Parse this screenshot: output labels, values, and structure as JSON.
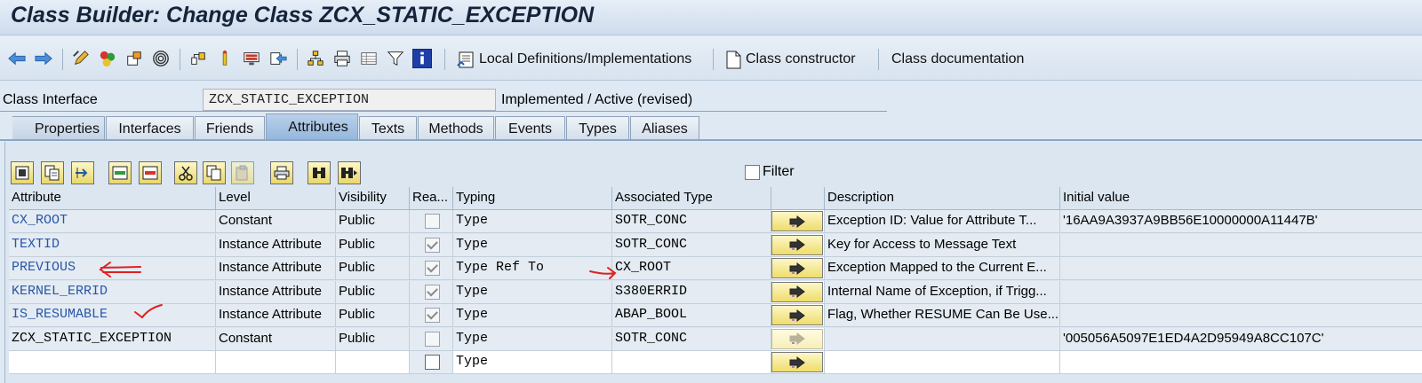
{
  "window": {
    "title": "Class Builder: Change Class ZCX_STATIC_EXCEPTION"
  },
  "toolbar": {
    "icons": [
      "back-arrow-icon",
      "forward-arrow-icon",
      "edit-pencil-icon",
      "check-icon",
      "activate-icon",
      "where-used-icon",
      "object-list-icon",
      "info-icon",
      "display-object-icon",
      "navigate-icon",
      "hierarchy-icon",
      "print-icon",
      "table-icon",
      "filter-icon",
      "help-info-icon"
    ],
    "local_defs_label": "Local Definitions/Implementations",
    "class_constructor_label": "Class constructor",
    "class_documentation_label": "Class documentation"
  },
  "iface": {
    "label": "Class Interface",
    "value": "ZCX_STATIC_EXCEPTION",
    "status": "Implemented / Active (revised)"
  },
  "tabs": [
    {
      "label": "Properties"
    },
    {
      "label": "Interfaces"
    },
    {
      "label": "Friends"
    },
    {
      "label": "Attributes"
    },
    {
      "label": "Texts"
    },
    {
      "label": "Methods"
    },
    {
      "label": "Events"
    },
    {
      "label": "Types"
    },
    {
      "label": "Aliases"
    }
  ],
  "active_tab": "Attributes",
  "grid_toolbar": {
    "icons": [
      "detail-icon",
      "copy-row-icon",
      "move-icon",
      "insert-row-icon",
      "delete-row-icon",
      "cut-icon",
      "copy-icon",
      "paste-icon",
      "print-icon",
      "find-icon",
      "find-next-icon"
    ],
    "filter_label": "Filter"
  },
  "table": {
    "headers": [
      "Attribute",
      "Level",
      "Visibility",
      "Rea...",
      "Typing",
      "Associated Type",
      "",
      "Description",
      "Initial value"
    ],
    "rows": [
      {
        "attribute": "CX_ROOT",
        "level": "Constant",
        "visibility": "Public",
        "readonly": false,
        "typing": "Type",
        "assoc": "SOTR_CONC",
        "description": "Exception ID: Value for Attribute T...",
        "initial": "'16AA9A3937A9BB56E10000000A11447B'"
      },
      {
        "attribute": "TEXTID",
        "level": "Instance Attribute",
        "visibility": "Public",
        "readonly": true,
        "typing": "Type",
        "assoc": "SOTR_CONC",
        "description": "Key for Access to Message Text",
        "initial": ""
      },
      {
        "attribute": "PREVIOUS",
        "level": "Instance Attribute",
        "visibility": "Public",
        "readonly": true,
        "typing": "Type Ref To",
        "assoc": "CX_ROOT",
        "description": "Exception Mapped to the Current E...",
        "initial": ""
      },
      {
        "attribute": "KERNEL_ERRID",
        "level": "Instance Attribute",
        "visibility": "Public",
        "readonly": true,
        "typing": "Type",
        "assoc": "S380ERRID",
        "description": "Internal Name of Exception, if Trigg...",
        "initial": ""
      },
      {
        "attribute": "IS_RESUMABLE",
        "level": "Instance Attribute",
        "visibility": "Public",
        "readonly": true,
        "typing": "Type",
        "assoc": "ABAP_BOOL",
        "description": "Flag, Whether RESUME Can Be Use...",
        "initial": ""
      },
      {
        "attribute": "ZCX_STATIC_EXCEPTION",
        "level": "Constant",
        "visibility": "Public",
        "readonly": false,
        "typing": "Type",
        "assoc": "SOTR_CONC",
        "description": "",
        "initial": "'005056A5097E1ED4A2D95949A8CC107C'"
      },
      {
        "attribute": "",
        "level": "",
        "visibility": "",
        "readonly": false,
        "typing": "Type",
        "assoc": "",
        "description": "",
        "initial": ""
      }
    ]
  },
  "colors": {
    "link": "#2957a6",
    "annotation": "#e02020",
    "active_tab": "#a9c5e6"
  }
}
